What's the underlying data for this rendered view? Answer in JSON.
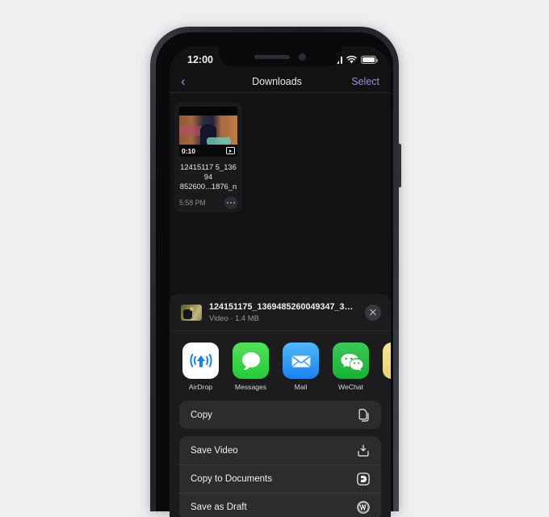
{
  "background_color": "#edeff1",
  "device": {
    "frame_color": "#23252b",
    "screen_background": "#121214",
    "hardware": {
      "mute_switch": "mute-switch",
      "volume_up": "volume-up-button",
      "volume_down": "volume-down-button",
      "power": "power-button"
    }
  },
  "status_bar": {
    "time": "12:00",
    "cellular_icon": "signal-bars-icon",
    "wifi_icon": "wifi-icon",
    "battery_icon": "battery-icon"
  },
  "nav_bar": {
    "back_icon": "chevron-left-icon",
    "back_glyph": "‹",
    "title": "Downloads",
    "action_label": "Select",
    "accent_color": "#9b8ed6"
  },
  "downloads": [
    {
      "duration": "0:10",
      "filename": "12415117 5_13694852600...1876_n",
      "filename_line1": "12415117 5_13694",
      "filename_line2": "852600...1876_n",
      "time": "5:58 PM",
      "more_icon": "ellipsis-icon",
      "media_badge_icon": "video-badge-icon"
    }
  ],
  "share_sheet": {
    "file_title": "124151175_1369485260049347_324...",
    "file_subtitle": "Video · 1.4 MB",
    "thumbnail_icon": "video-thumbnail",
    "close_icon": "close-icon",
    "apps": [
      {
        "label": "AirDrop",
        "icon": "airdrop-icon",
        "color": "#ffffff"
      },
      {
        "label": "Messages",
        "icon": "messages-icon",
        "color": "#30cf42"
      },
      {
        "label": "Mail",
        "icon": "mail-icon",
        "color": "#1f8ef1"
      },
      {
        "label": "WeChat",
        "icon": "wechat-icon",
        "color": "#1fb93c"
      },
      {
        "label": "",
        "icon": "partial-app-icon",
        "color": "#f0d887"
      }
    ],
    "action_groups": [
      {
        "actions": [
          {
            "label": "Copy",
            "icon": "copy-icon"
          }
        ]
      },
      {
        "actions": [
          {
            "label": "Save Video",
            "icon": "save-to-photos-icon"
          },
          {
            "label": "Copy to Documents",
            "icon": "documents-app-icon"
          },
          {
            "label": "Save as Draft",
            "icon": "wordpress-icon"
          }
        ]
      }
    ]
  }
}
